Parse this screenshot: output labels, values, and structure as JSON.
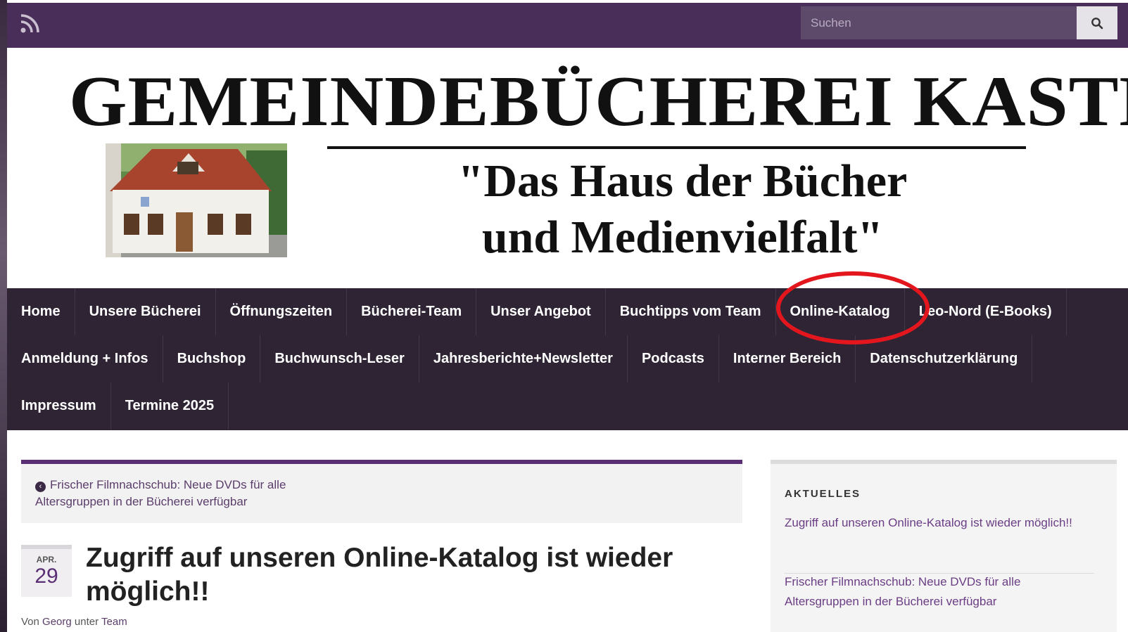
{
  "topbar": {
    "rss_icon": "rss-icon",
    "search_placeholder": "Suchen",
    "search_icon": "search-icon"
  },
  "header": {
    "site_title": "GEMEINDEBÜCHEREI KASTL",
    "tagline_line1": "\"Das Haus der Bücher",
    "tagline_line2": "und Medienvielfalt\""
  },
  "nav": {
    "row1": [
      "Home",
      "Unsere Bücherei",
      "Öffnungszeiten",
      "Bücherei-Team",
      "Unser Angebot",
      "Buchtipps vom Team",
      "Online-Katalog",
      "Leo-Nord (E-Books)"
    ],
    "row2": [
      "Anmeldung + Infos",
      "Buchshop",
      "Buchwunsch-Leser",
      "Jahresberichte+Newsletter",
      "Podcasts",
      "Interner Bereich",
      "Datenschutzerklärung"
    ],
    "row3": [
      "Impressum",
      "Termine 2025"
    ],
    "highlight_color": "#e3161e"
  },
  "post_nav": {
    "previous_label": "Frischer Filmnachschub: Neue DVDs für alle Altersgruppen in der Bücherei verfügbar"
  },
  "post": {
    "month": "APR.",
    "day": "29",
    "title": "Zugriff auf unseren Online-Katalog ist wieder möglich!!",
    "meta_by": "Von",
    "author": "Georg",
    "meta_under": "unter",
    "category": "Team"
  },
  "sidebar": {
    "title": "AKTUELLES",
    "items": [
      "Zugriff auf unseren Online-Katalog ist wieder möglich!!",
      "Frischer Filmnachschub: Neue DVDs für alle Altersgruppen in der Bücherei verfügbar"
    ]
  },
  "colors": {
    "topbar": "#4a2e5a",
    "nav": "#2f2434",
    "accent": "#5a2e74",
    "link": "#6a3d84"
  }
}
